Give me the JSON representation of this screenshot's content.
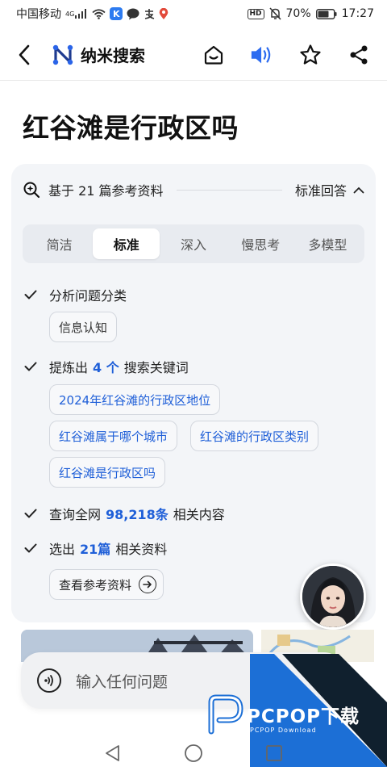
{
  "status_bar": {
    "carrier": "中国移动",
    "network": "4G",
    "battery": "70%",
    "time": "17:27",
    "hd_label": "HD",
    "k_label": "K"
  },
  "nav": {
    "brand_name": "纳米搜索"
  },
  "page": {
    "title": "红谷滩是行政区吗"
  },
  "card": {
    "ref_text": "基于 21 篇参考资料",
    "mode_label": "标准回答",
    "tabs": [
      {
        "label": "简洁",
        "active": false
      },
      {
        "label": "标准",
        "active": true
      },
      {
        "label": "深入",
        "active": false
      },
      {
        "label": "慢思考",
        "active": false
      },
      {
        "label": "多模型",
        "active": false
      }
    ],
    "steps": {
      "analyze": {
        "label": "分析问题分类",
        "chip": "信息认知"
      },
      "keywords": {
        "prefix": "提炼出",
        "count": "4 个",
        "suffix": "搜索关键词",
        "chips": [
          "2024年红谷滩的行政区地位",
          "红谷滩属于哪个城市",
          "红谷滩的行政区类别",
          "红谷滩是行政区吗"
        ]
      },
      "query": {
        "prefix": "查询全网",
        "count": "98,218条",
        "suffix": "相关内容"
      },
      "select": {
        "prefix": "选出",
        "count": "21篇",
        "suffix": "相关资料",
        "button": "查看参考资料"
      }
    }
  },
  "input": {
    "placeholder": "输入任何问题"
  },
  "watermark": {
    "brand": "PCPOP下载",
    "sub": "PCPOP Download"
  },
  "colors": {
    "accent": "#1f5fd8",
    "voice_blue": "#2d6cf0",
    "card_bg": "#f3f5f8",
    "watermark_blue": "#1c6fd6"
  }
}
